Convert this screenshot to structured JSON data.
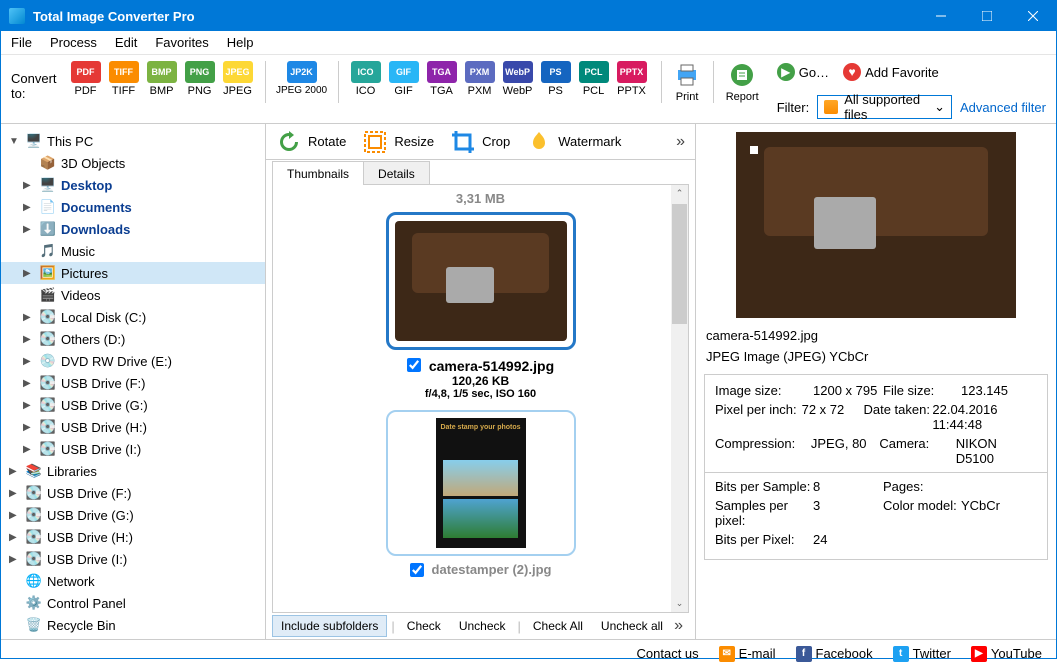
{
  "title": "Total Image Converter Pro",
  "menu": [
    "File",
    "Process",
    "Edit",
    "Favorites",
    "Help"
  ],
  "convertLabel": "Convert to:",
  "formats": [
    {
      "id": "PDF",
      "bg": "#e53935"
    },
    {
      "id": "TIFF",
      "bg": "#fb8c00"
    },
    {
      "id": "BMP",
      "bg": "#7cb342"
    },
    {
      "id": "PNG",
      "bg": "#43a047"
    },
    {
      "id": "JPEG",
      "bg": "#fdd835"
    },
    {
      "id": "JPEG 2000",
      "short": "JP2K",
      "bg": "#1e88e5"
    },
    {
      "id": "ICO",
      "bg": "#26a69a"
    },
    {
      "id": "GIF",
      "bg": "#29b6f6"
    },
    {
      "id": "TGA",
      "bg": "#8e24aa"
    },
    {
      "id": "PXM",
      "bg": "#5c6bc0"
    },
    {
      "id": "WebP",
      "bg": "#3949ab"
    },
    {
      "id": "PS",
      "bg": "#1565c0"
    },
    {
      "id": "PCL",
      "bg": "#00897b"
    },
    {
      "id": "PPTX",
      "bg": "#d81b60"
    }
  ],
  "printLabel": "Print",
  "reportLabel": "Report",
  "go": "Go…",
  "addFav": "Add Favorite",
  "filterLabel": "Filter:",
  "filterValue": "All supported files",
  "advFilter": "Advanced filter",
  "edit": {
    "rotate": "Rotate",
    "resize": "Resize",
    "crop": "Crop",
    "watermark": "Watermark"
  },
  "tabs": {
    "thumbs": "Thumbnails",
    "details": "Details"
  },
  "sizeTop": "3,31 MB",
  "thumb1": {
    "name": "camera-514992.jpg",
    "size": "120,26 KB",
    "meta": "f/4,8, 1/5 sec, ISO 160"
  },
  "thumb2": {
    "label": "Date stamp your photos",
    "name": "datestamper (2).jpg"
  },
  "bottom": {
    "include": "Include subfolders",
    "check": "Check",
    "uncheck": "Uncheck",
    "checkAll": "Check All",
    "uncheckAll": "Uncheck all"
  },
  "tree": [
    {
      "l": 0,
      "exp": "▼",
      "ic": "🖥️",
      "txt": "This PC",
      "bold": false
    },
    {
      "l": 1,
      "exp": "",
      "ic": "📦",
      "txt": "3D Objects"
    },
    {
      "l": 1,
      "exp": "▶",
      "ic": "🖥️",
      "txt": "Desktop",
      "bold": true
    },
    {
      "l": 1,
      "exp": "▶",
      "ic": "📄",
      "txt": "Documents",
      "bold": true
    },
    {
      "l": 1,
      "exp": "▶",
      "ic": "⬇️",
      "txt": "Downloads",
      "bold": true
    },
    {
      "l": 1,
      "exp": "",
      "ic": "🎵",
      "txt": "Music"
    },
    {
      "l": 1,
      "exp": "▶",
      "ic": "🖼️",
      "txt": "Pictures",
      "sel": true
    },
    {
      "l": 1,
      "exp": "",
      "ic": "🎬",
      "txt": "Videos"
    },
    {
      "l": 1,
      "exp": "▶",
      "ic": "💽",
      "txt": "Local Disk (C:)"
    },
    {
      "l": 1,
      "exp": "▶",
      "ic": "💽",
      "txt": "Others (D:)"
    },
    {
      "l": 1,
      "exp": "▶",
      "ic": "💿",
      "txt": "DVD RW Drive (E:)"
    },
    {
      "l": 1,
      "exp": "▶",
      "ic": "💽",
      "txt": "USB Drive (F:)"
    },
    {
      "l": 1,
      "exp": "▶",
      "ic": "💽",
      "txt": "USB Drive (G:)"
    },
    {
      "l": 1,
      "exp": "▶",
      "ic": "💽",
      "txt": "USB Drive (H:)"
    },
    {
      "l": 1,
      "exp": "▶",
      "ic": "💽",
      "txt": "USB Drive (I:)"
    },
    {
      "l": 0,
      "exp": "▶",
      "ic": "📚",
      "txt": "Libraries"
    },
    {
      "l": 0,
      "exp": "▶",
      "ic": "💽",
      "txt": "USB Drive (F:)"
    },
    {
      "l": 0,
      "exp": "▶",
      "ic": "💽",
      "txt": "USB Drive (G:)"
    },
    {
      "l": 0,
      "exp": "▶",
      "ic": "💽",
      "txt": "USB Drive (H:)"
    },
    {
      "l": 0,
      "exp": "▶",
      "ic": "💽",
      "txt": "USB Drive (I:)"
    },
    {
      "l": 0,
      "exp": "",
      "ic": "🌐",
      "txt": "Network"
    },
    {
      "l": 0,
      "exp": "",
      "ic": "⚙️",
      "txt": "Control Panel"
    },
    {
      "l": 0,
      "exp": "",
      "ic": "🗑️",
      "txt": "Recycle Bin"
    }
  ],
  "preview": {
    "filename": "camera-514992.jpg",
    "type": "JPEG Image (JPEG) YCbCr",
    "rows1": [
      {
        "k": "Image size:",
        "v": "1200 x 795",
        "k2": "File size:",
        "v2": "123.145"
      },
      {
        "k": "Pixel per inch:",
        "v": "72 x 72",
        "k2": "Date taken:",
        "v2": "22.04.2016 11:44:48"
      },
      {
        "k": "Compression:",
        "v": "JPEG, 80",
        "k2": "Camera:",
        "v2": "NIKON D5100"
      }
    ],
    "rows2": [
      {
        "k": "Bits per Sample:",
        "v": "8",
        "k2": "Pages:",
        "v2": ""
      },
      {
        "k": "Samples per pixel:",
        "v": "3",
        "k2": "Color model:",
        "v2": "YCbCr"
      },
      {
        "k": "Bits per Pixel:",
        "v": "24",
        "k2": "",
        "v2": ""
      }
    ]
  },
  "footer": {
    "contact": "Contact us",
    "email": "E-mail",
    "fb": "Facebook",
    "tw": "Twitter",
    "yt": "YouTube"
  }
}
